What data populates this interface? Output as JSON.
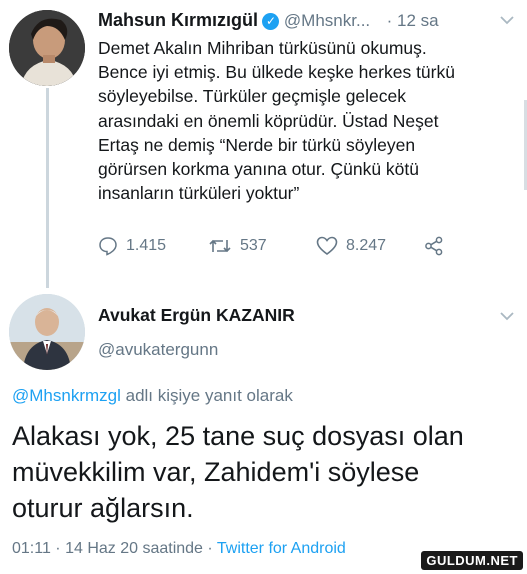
{
  "tweet": {
    "author_name": "Mahsun Kırmızıgül",
    "handle": "@Mhsnkr...",
    "time": "· 12 sa",
    "text_lines": [
      "Demet Akalın Mihriban türküsünü okumuş.",
      "Bence iyi etmiş. Bu ülkede keşke herkes türkü",
      "söyleyebilse.  Türküler geçmişle gelecek",
      "arasındaki en önemli köprüdür. Üstad Neşet",
      "Ertaş ne demiş  “Nerde bir türkü söyleyen",
      "görürsen korkma yanına otur. Çünkü kötü",
      "insanların türküleri yoktur”"
    ],
    "replies": "1.415",
    "retweets": "537",
    "likes": "8.247"
  },
  "reply": {
    "author_name": "Avukat Ergün KAZANIR",
    "handle": "@avukatergunn",
    "reply_to_handle": "@Mhsnkrmzgl",
    "reply_to_suffix": " adlı kişiye yanıt olarak",
    "text_lines": [
      "Alakası yok, 25 tane suç dosyası olan",
      "müvekkilim var, Zahidem'i söylese",
      "oturur ağlarsın."
    ],
    "timestamp": "01:11 · 14 Haz 20 saatinde · ",
    "source": "Twitter for Android"
  },
  "watermark": "GULDUM.NET",
  "icons": [
    "reply-icon",
    "retweet-icon",
    "like-icon",
    "share-icon",
    "chevron-down-icon",
    "verified-badge-icon"
  ],
  "colors": {
    "link": "#1da1f2",
    "muted": "#657786",
    "text": "#14171a"
  }
}
